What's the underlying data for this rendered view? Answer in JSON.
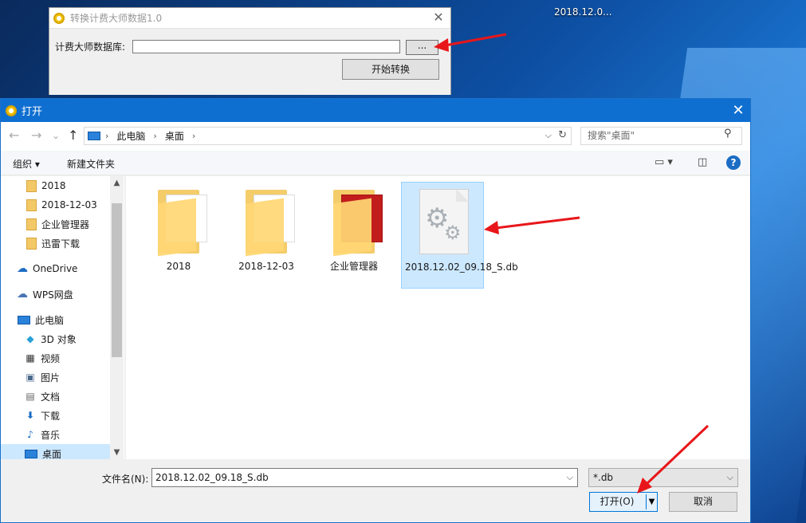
{
  "desktop": {
    "icon_label": "2018.12.0..."
  },
  "app": {
    "title": "转换计费大师数据1.0",
    "db_label": "计费大师数据库:",
    "db_value": "",
    "browse_label": "...",
    "start_label": "开始转换",
    "close": "✕"
  },
  "dialog": {
    "title": "打开",
    "close": "✕",
    "nav": {
      "back": "←",
      "forward": "→",
      "recent": "⌄",
      "up": "↑"
    },
    "breadcrumb": [
      "此电脑",
      "桌面"
    ],
    "refresh": "↻",
    "search_placeholder": "搜索\"桌面\"",
    "toolbar": {
      "organize": "组织 ▾",
      "new_folder": "新建文件夹",
      "view_icon": "▭ ▾",
      "pane_icon": "◫",
      "help": "?"
    },
    "sidebar": [
      {
        "label": "2018",
        "icon": "folder-icon"
      },
      {
        "label": "2018-12-03",
        "icon": "folder-icon"
      },
      {
        "label": "企业管理器",
        "icon": "folder-icon"
      },
      {
        "label": "迅雷下载",
        "icon": "folder-icon"
      },
      {
        "label": "OneDrive",
        "icon": "cloud-icon"
      },
      {
        "label": "WPS网盘",
        "icon": "cloud-icon"
      },
      {
        "label": "此电脑",
        "icon": "computer-icon"
      },
      {
        "label": "3D 对象",
        "icon": "cube-icon"
      },
      {
        "label": "视频",
        "icon": "video-icon"
      },
      {
        "label": "图片",
        "icon": "picture-icon"
      },
      {
        "label": "文档",
        "icon": "document-icon"
      },
      {
        "label": "下载",
        "icon": "download-icon"
      },
      {
        "label": "音乐",
        "icon": "music-icon"
      },
      {
        "label": "桌面",
        "icon": "desktop-icon"
      }
    ],
    "files": [
      {
        "name": "2018",
        "type": "folder"
      },
      {
        "name": "2018-12-03",
        "type": "folder"
      },
      {
        "name": "企业管理器",
        "type": "folder"
      },
      {
        "name": "2018.12.02_09.18_S.db",
        "type": "db-file"
      }
    ],
    "filename_label": "文件名(N):",
    "filename_value": "2018.12.02_09.18_S.db",
    "filter_value": "*.db",
    "open_label": "打开(O)",
    "cancel_label": "取消"
  },
  "colors": {
    "accent": "#0f6fd1",
    "selection": "#cce8ff",
    "arrow": "#e8161a"
  }
}
